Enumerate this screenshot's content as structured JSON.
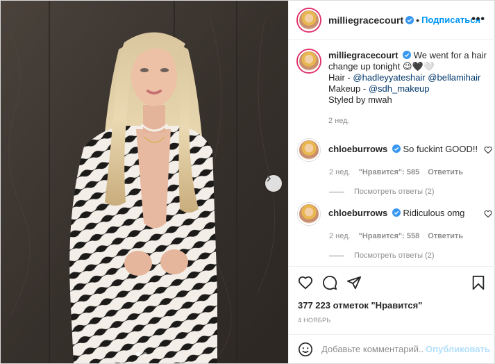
{
  "header": {
    "username": "milliegracecourt",
    "separator": "•",
    "follow_label": "Подписаться",
    "more_label": "•••"
  },
  "caption": {
    "username": "milliegracecourt",
    "line1": "We went for a hair change up tonight 😉🖤🤍",
    "hair_prefix": "Hair - ",
    "hair_mention1": "@hadleyyateshair",
    "hair_mention2": "@bellamihair",
    "makeup_prefix": "Makeup - ",
    "makeup_mention": "@sdh_makeup",
    "styled": "Styled by mwah",
    "time": "2 нед."
  },
  "comments": [
    {
      "username": "chloeburrows",
      "text": "So fuckint GOOD!!",
      "time": "2 нед.",
      "likes": "\"Нравится\": 585",
      "reply": "Ответить",
      "view_replies": "Посмотреть ответы (2)"
    },
    {
      "username": "chloeburrows",
      "text": "Ridiculous omg",
      "time": "2 нед.",
      "likes": "\"Нравится\": 558",
      "reply": "Ответить",
      "view_replies": "Посмотреть ответы (2)"
    }
  ],
  "likes_count": "377 223 отметок \"Нравится\"",
  "date": "4 НОЯБРЬ",
  "add_comment": {
    "placeholder": "Добавьте комментарий...",
    "publish_label": "Опубликовать"
  },
  "carousel": {
    "total": 2,
    "current": 1
  },
  "colors": {
    "accent": "#0095f6",
    "verified": "#3897f0",
    "publish_disabled": "#b2dffc"
  },
  "icons": [
    "verified-badge-icon",
    "heart-icon",
    "comment-icon",
    "share-icon",
    "bookmark-icon",
    "emoji-icon",
    "chevron-right-icon",
    "more-icon"
  ]
}
